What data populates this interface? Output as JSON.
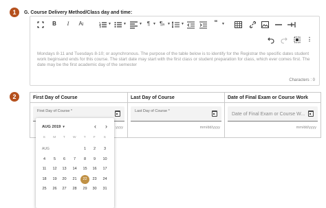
{
  "steps": [
    "1",
    "2"
  ],
  "question": {
    "title": "G. Course Delivery Method/Class day and time:"
  },
  "editor": {
    "body": "Mondays 8-11 and Tuesdays 8-10; or asynchronous. The purpose of the table below is to identify for the Registrar the specific dates student work beginsand ends for this course. The start date may start with the first class or student preparation for class, which ever comes first. The date may be the first academic day of the semester",
    "char_count": "Characters : 0"
  },
  "toolbar_icons": [
    "expand-icon",
    "bold-icon",
    "italic-icon",
    "font-size-icon",
    "numbered-list-icon",
    "bullet-list-icon",
    "align-icon",
    "paragraph-icon",
    "paragraph-format-icon",
    "line-height-icon",
    "outdent-icon",
    "indent-icon",
    "quote-icon",
    "table-icon",
    "link-icon",
    "image-icon",
    "horizontal-rule-icon",
    "special-char-icon",
    "undo-icon",
    "redo-icon",
    "select-all-icon",
    "more-icon"
  ],
  "date_table": {
    "columns": [
      {
        "header": "First Day of Course",
        "label": "First Day of Course *",
        "placeholder": "",
        "hint": "yyyy"
      },
      {
        "header": "Last Day of Course",
        "label": "Last Day of Course *",
        "placeholder": "",
        "hint": "mm/dd/yyyy"
      },
      {
        "header": "Date of Final Exam or Course Work",
        "label": "",
        "placeholder": "Date of Final Exam or Course W...",
        "hint": "mm/dd/yyyy"
      }
    ]
  },
  "datepicker": {
    "month_label": "AUG 2019",
    "month_abbr": "AUG",
    "weekdays": [
      "S",
      "M",
      "T",
      "W",
      "T",
      "F",
      "S"
    ],
    "selected_day": "22",
    "weeks": [
      [
        "",
        "",
        "",
        "",
        "1",
        "2",
        "3"
      ],
      [
        "4",
        "5",
        "6",
        "7",
        "8",
        "9",
        "10"
      ],
      [
        "11",
        "12",
        "13",
        "14",
        "15",
        "16",
        "17"
      ],
      [
        "18",
        "19",
        "20",
        "21",
        "22",
        "23",
        "24"
      ],
      [
        "25",
        "26",
        "27",
        "28",
        "29",
        "30",
        "31"
      ]
    ]
  }
}
